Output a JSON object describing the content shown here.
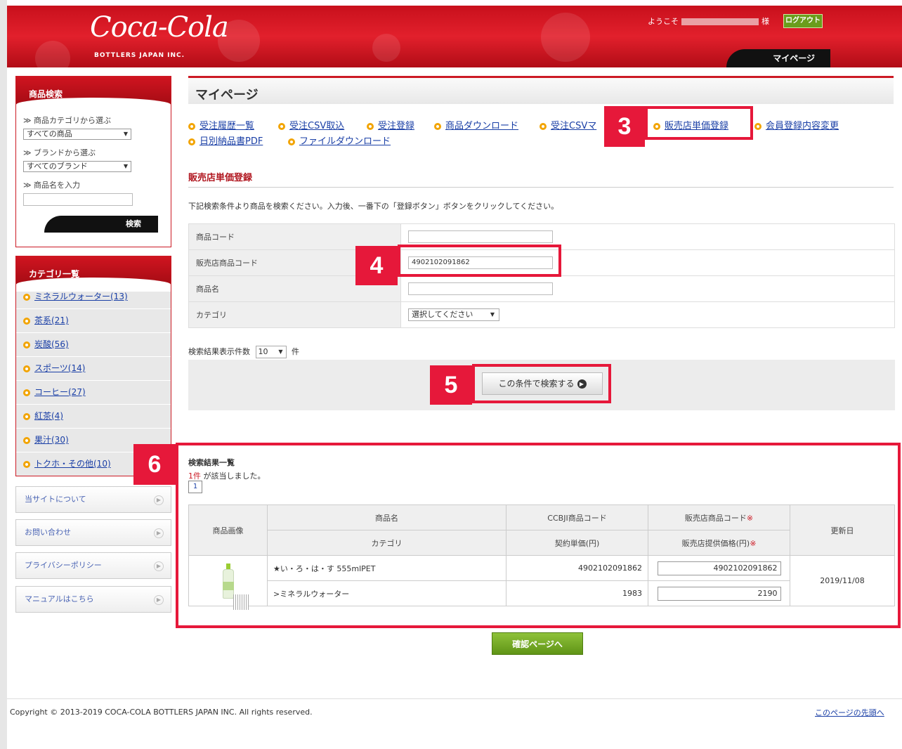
{
  "header": {
    "logo_text": "Coca-Cola",
    "logo_sub": "BOTTLERS JAPAN INC.",
    "welcome_prefix": "ようこそ",
    "welcome_suffix": "様",
    "logout_label": "ログアウト",
    "mypage_tab": "マイページ"
  },
  "sidebar": {
    "search": {
      "title": "商品検索",
      "category_label": "≫ 商品カテゴリから選ぶ",
      "category_value": "すべての商品",
      "brand_label": "≫ ブランドから選ぶ",
      "brand_value": "すべてのブランド",
      "name_label": "≫ 商品名を入力",
      "button": "検索"
    },
    "category_title": "カテゴリ一覧",
    "categories": [
      "ミネラルウォーター(13)",
      "茶系(21)",
      "炭酸(56)",
      "スポーツ(14)",
      "コーヒー(27)",
      "紅茶(4)",
      "果汁(30)",
      "トクホ・その他(10)"
    ],
    "links": [
      "当サイトについて",
      "お問い合わせ",
      "プライバシーポリシー",
      "マニュアルはこちら"
    ]
  },
  "main": {
    "page_title": "マイページ",
    "nav": [
      "受注履歴一覧",
      "受注CSV取込",
      "受注登録",
      "商品ダウンロード",
      "受注CSVマ",
      "販売店単価登録",
      "会員登録内容変更",
      "日別納品書PDF",
      "ファイルダウンロード"
    ],
    "section_title": "販売店単価登録",
    "instruction": "下記検索条件より商品を検索ください。入力後、一番下の「登録ボタン」ボタンをクリックしてください。",
    "form": {
      "rows": [
        {
          "label": "商品コード",
          "value": ""
        },
        {
          "label": "販売店商品コード",
          "value": "4902102091862"
        },
        {
          "label": "商品名",
          "value": ""
        },
        {
          "label": "カテゴリ",
          "value": "選択してください"
        }
      ]
    },
    "results_per_page_label": "検索結果表示件数",
    "results_per_page_value": "10",
    "results_per_page_unit": "件",
    "search_button": "この条件で検索する",
    "results": {
      "title": "検索結果一覧",
      "count_num": "1件",
      "count_text": "が該当しました。",
      "page": "1",
      "headers": {
        "image": "商品画像",
        "name": "商品名",
        "category": "カテゴリ",
        "ccbji_code": "CCBJI商品コード",
        "unit_price": "契約単価(円)",
        "shop_code": "販売店商品コード",
        "shop_price": "販売店提供価格(円)",
        "updated": "更新日",
        "required_mark": "※"
      },
      "rows": [
        {
          "name": "★い・ろ・は・す 555mlPET",
          "category": ">ミネラルウォーター",
          "ccbji_code": "4902102091862",
          "unit_price": "1983",
          "shop_code": "4902102091862",
          "shop_price": "2190",
          "updated": "2019/11/08"
        }
      ]
    },
    "confirm_button": "確認ページへ"
  },
  "footer": {
    "copyright": "Copyright © 2013-2019 COCA-COLA BOTTLERS JAPAN INC. All rights reserved.",
    "to_top": "このページの先頭へ"
  },
  "annotations": [
    "3",
    "4",
    "5",
    "6"
  ],
  "colors": {
    "brand_red": "#cc1a24",
    "annotation_red": "#e6183a",
    "accent_green": "#6a9d1c",
    "link_blue": "#1a3fa6"
  }
}
